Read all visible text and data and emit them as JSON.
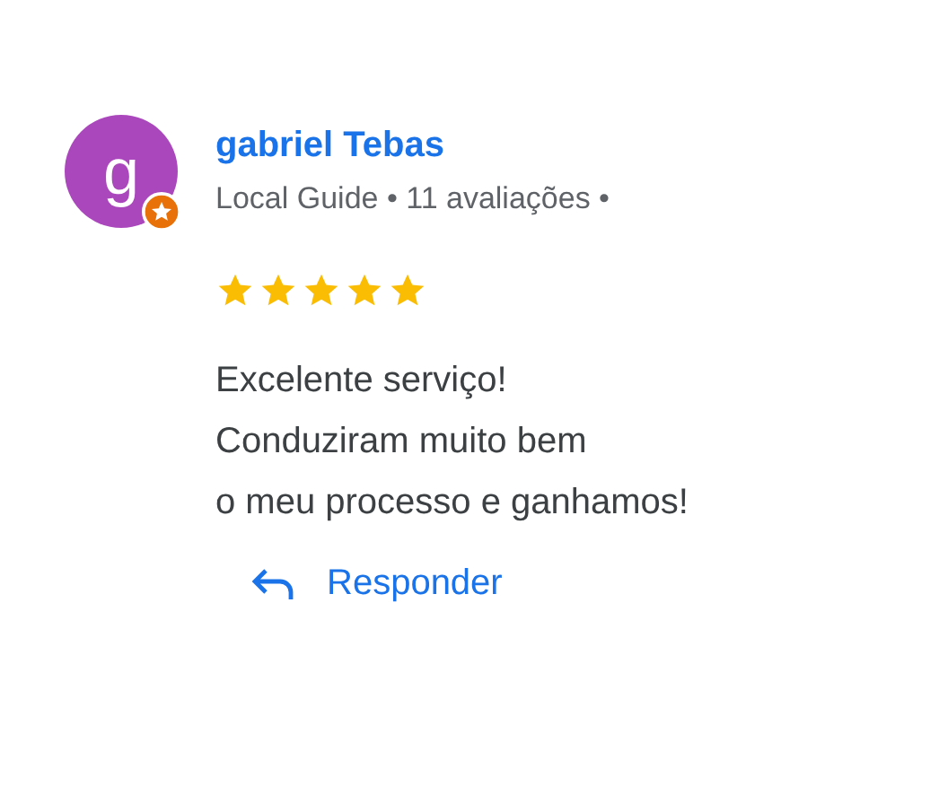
{
  "review": {
    "avatar": {
      "letter": "g",
      "color": "#ab47bc",
      "badge": true
    },
    "author": "gabriel Tebas",
    "meta": "Local Guide • 11 avaliações •",
    "stars": 5,
    "text": "Excelente serviço!\nConduziram muito bem\no meu processo e ganhamos!",
    "reply_button": "Responder"
  }
}
